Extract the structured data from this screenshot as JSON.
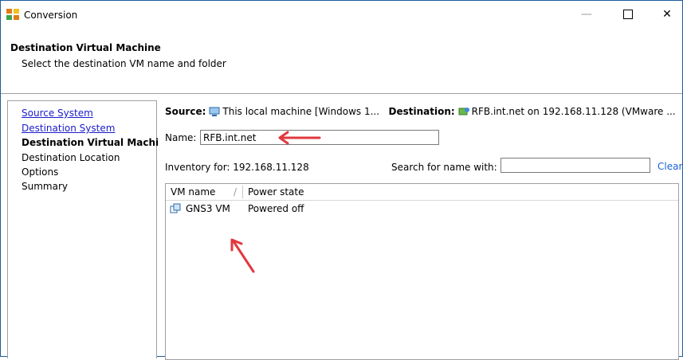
{
  "window": {
    "title": "Conversion",
    "minimize": "—",
    "close": "✕"
  },
  "header": {
    "title": "Destination Virtual Machine",
    "subtitle": "Select the destination VM name and folder"
  },
  "nav": {
    "items": [
      {
        "label": "Source System",
        "state": "link"
      },
      {
        "label": "Destination System",
        "state": "link"
      },
      {
        "label": "Destination Virtual Machine",
        "state": "current"
      },
      {
        "label": "Destination Location",
        "state": "normal"
      },
      {
        "label": "Options",
        "state": "normal"
      },
      {
        "label": "Summary",
        "state": "normal"
      }
    ]
  },
  "summary": {
    "source_label": "Source:",
    "source_value": "This local machine [Windows 1...",
    "destination_label": "Destination:",
    "destination_value": "RFB.int.net on 192.168.11.128 (VMware ..."
  },
  "form": {
    "name_label": "Name:",
    "name_value": "RFB.int.net",
    "inventory_label": "Inventory for: 192.168.11.128",
    "search_label": "Search for name with:",
    "search_value": "",
    "clear_label": "Clear"
  },
  "table": {
    "columns": [
      "VM name",
      "Power state"
    ],
    "sort_indicator": "/",
    "rows": [
      {
        "vm_name": "GNS3 VM",
        "power_state": "Powered off"
      }
    ]
  },
  "colors": {
    "window_border": "#1e5b9e",
    "link": "#1a1acc",
    "annotation_arrow": "#e0393e"
  }
}
